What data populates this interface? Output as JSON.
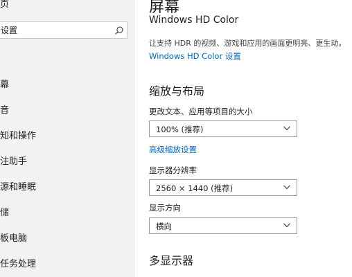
{
  "sidebar": {
    "top_label": "页",
    "search": {
      "placeholder": "设置"
    },
    "marker": "",
    "items": [
      {
        "label": "幕"
      },
      {
        "label": "音"
      },
      {
        "label": "知和操作"
      },
      {
        "label": "注助手"
      },
      {
        "label": "源和睡眠"
      },
      {
        "label": "储"
      },
      {
        "label": "板电脑"
      },
      {
        "label": "任务处理"
      }
    ]
  },
  "main": {
    "page_title": "屏幕",
    "hdr": {
      "title": "Windows HD Color",
      "description": "让支持 HDR 的视频、游戏和应用的画面更明亮、更生动。",
      "link": "Windows HD Color 设置"
    },
    "scale_layout": {
      "title": "缩放与布局",
      "scale_label": "更改文本、应用等项目的大小",
      "scale_value": "100% (推荐)",
      "advanced_link": "高级缩放设置",
      "resolution_label": "显示器分辨率",
      "resolution_value": "2560 × 1440 (推荐)",
      "orientation_label": "显示方向",
      "orientation_value": "横向"
    },
    "multi_display": {
      "title": "多显示器"
    }
  }
}
